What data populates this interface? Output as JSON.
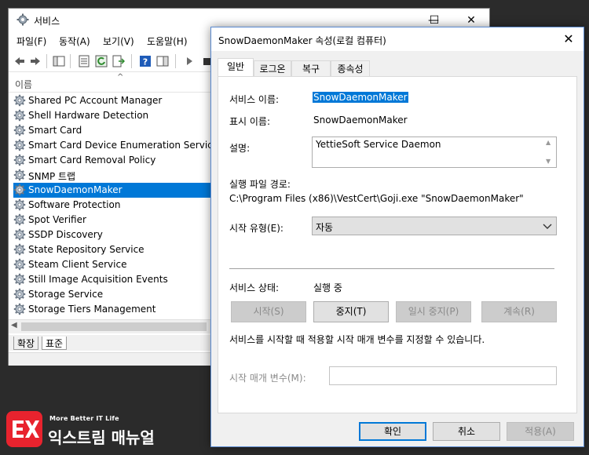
{
  "services_window": {
    "title": "서비스",
    "menu": [
      "파일(F)",
      "동작(A)",
      "보기(V)",
      "도움말(H)"
    ],
    "column_header": "이름",
    "services": [
      "Shared PC Account Manager",
      "Shell Hardware Detection",
      "Smart Card",
      "Smart Card Device Enumeration Service",
      "Smart Card Removal Policy",
      "SNMP 트랩",
      "SnowDaemonMaker",
      "Software Protection",
      "Spot Verifier",
      "SSDP Discovery",
      "State Repository Service",
      "Steam Client Service",
      "Still Image Acquisition Events",
      "Storage Service",
      "Storage Tiers Management"
    ],
    "selected_service": "SnowDaemonMaker",
    "bottom_tabs": [
      "확장",
      "표준"
    ],
    "controls": {
      "minimize": "—",
      "maximize": "☐",
      "close": "✕"
    }
  },
  "dialog": {
    "title": "SnowDaemonMaker 속성(로컬 컴퓨터)",
    "close": "✕",
    "tabs": [
      "일반",
      "로그온",
      "복구",
      "종속성"
    ],
    "active_tab": "일반",
    "service_name_label": "서비스 이름:",
    "service_name_value": "SnowDaemonMaker",
    "display_name_label": "표시 이름:",
    "display_name_value": "SnowDaemonMaker",
    "description_label": "설명:",
    "description_value": "YettieSoft Service Daemon",
    "exe_path_label": "실행 파일 경로:",
    "exe_path_value": "C:\\Program Files (x86)\\VestCert\\Goji.exe \"SnowDaemonMaker\"",
    "startup_type_label": "시작 유형(E):",
    "startup_type_value": "자동",
    "status_label": "서비스 상태:",
    "status_value": "실행 중",
    "buttons": {
      "start": "시작(S)",
      "stop": "중지(T)",
      "pause": "일시 중지(P)",
      "resume": "계속(R)"
    },
    "param_note": "서비스를 시작할 때 적용할 시작 매개 변수를 지정할 수 있습니다.",
    "param_label": "시작 매개 변수(M):",
    "param_value": "",
    "footer": {
      "ok": "확인",
      "cancel": "취소",
      "apply": "적용(A)"
    }
  },
  "watermark": {
    "tagline": "More Better IT Life",
    "brand": "익스트림 매뉴얼"
  },
  "colors": {
    "selection": "#0078d7",
    "dialog_bg": "#f0f0f0",
    "desktop": "#2b2b2b",
    "logo_red": "#e8232e"
  }
}
